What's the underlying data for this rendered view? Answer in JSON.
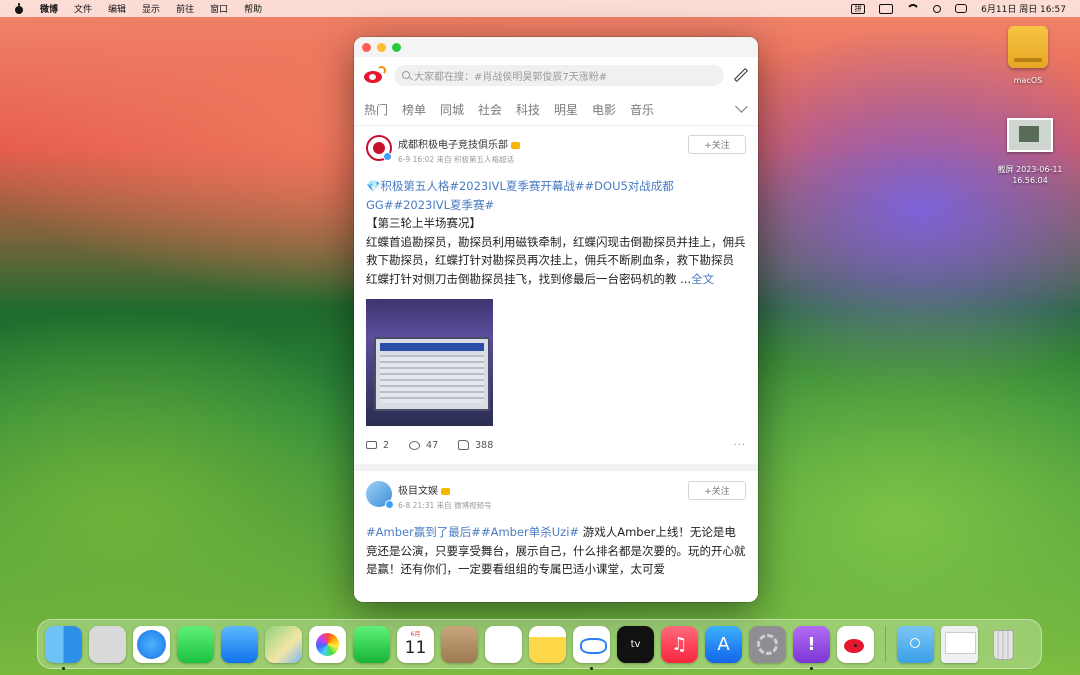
{
  "menubar": {
    "app_name": "微博",
    "items": [
      "文件",
      "编辑",
      "显示",
      "前往",
      "窗口",
      "帮助"
    ],
    "input_method": "拼",
    "clock": "6月11日 周日  16:57"
  },
  "desktop": {
    "drive_label": "macOS",
    "screenshot_label_1": "截屏 2023-06-11",
    "screenshot_label_2": "16.56.04"
  },
  "weibo": {
    "search_placeholder": "大家都在搜：#肖战侯明昊郭俊辰7天涨粉#",
    "tabs": [
      "热门",
      "榜单",
      "同城",
      "社会",
      "科技",
      "明星",
      "电影",
      "音乐"
    ],
    "posts": [
      {
        "author": "成都积极电子竞技俱乐部",
        "meta": "6-9 16:02 来自 积极第五人格超话",
        "follow_label": "+关注",
        "hashtags_line": "💎积极第五人格#2023IVL夏季赛开幕战##DOU5对战成都GG##2023IVL夏季赛#",
        "heading": "【第三轮上半场赛况】",
        "para1": "红蝶首追勘探员，勘探员利用磁铁牵制，红蝶闪现击倒勘探员并挂上，佣兵救下勘探员，红蝶打针对勘探员再次挂上，佣兵不断刷血条，救下勘探员",
        "para2": "红蝶打针对侧刀击倒勘探员挂飞，找到修最后一台密码机的教 ...",
        "more_link": "全文",
        "reposts": "2",
        "comments": "47",
        "likes": "388"
      },
      {
        "author": "极目文娱",
        "meta": "6-8 21:31 来自 微博视频号",
        "follow_label": "+关注",
        "hashtags": "#Amber赢到了最后##Amber单杀Uzi#",
        "text": " 游戏人Amber上线！无论是电竞还是公演，只要享受舞台，展示自己，什么排名都是次要的。玩的开心就是赢！还有你们，一定要看组组的专属巴适小课堂，太可爱"
      }
    ]
  },
  "dock": {
    "calendar_month": "6月",
    "calendar_day": "11",
    "tv_label": "tv",
    "music_glyph": "♫",
    "appstore_glyph": "A",
    "feedback_glyph": "!"
  }
}
